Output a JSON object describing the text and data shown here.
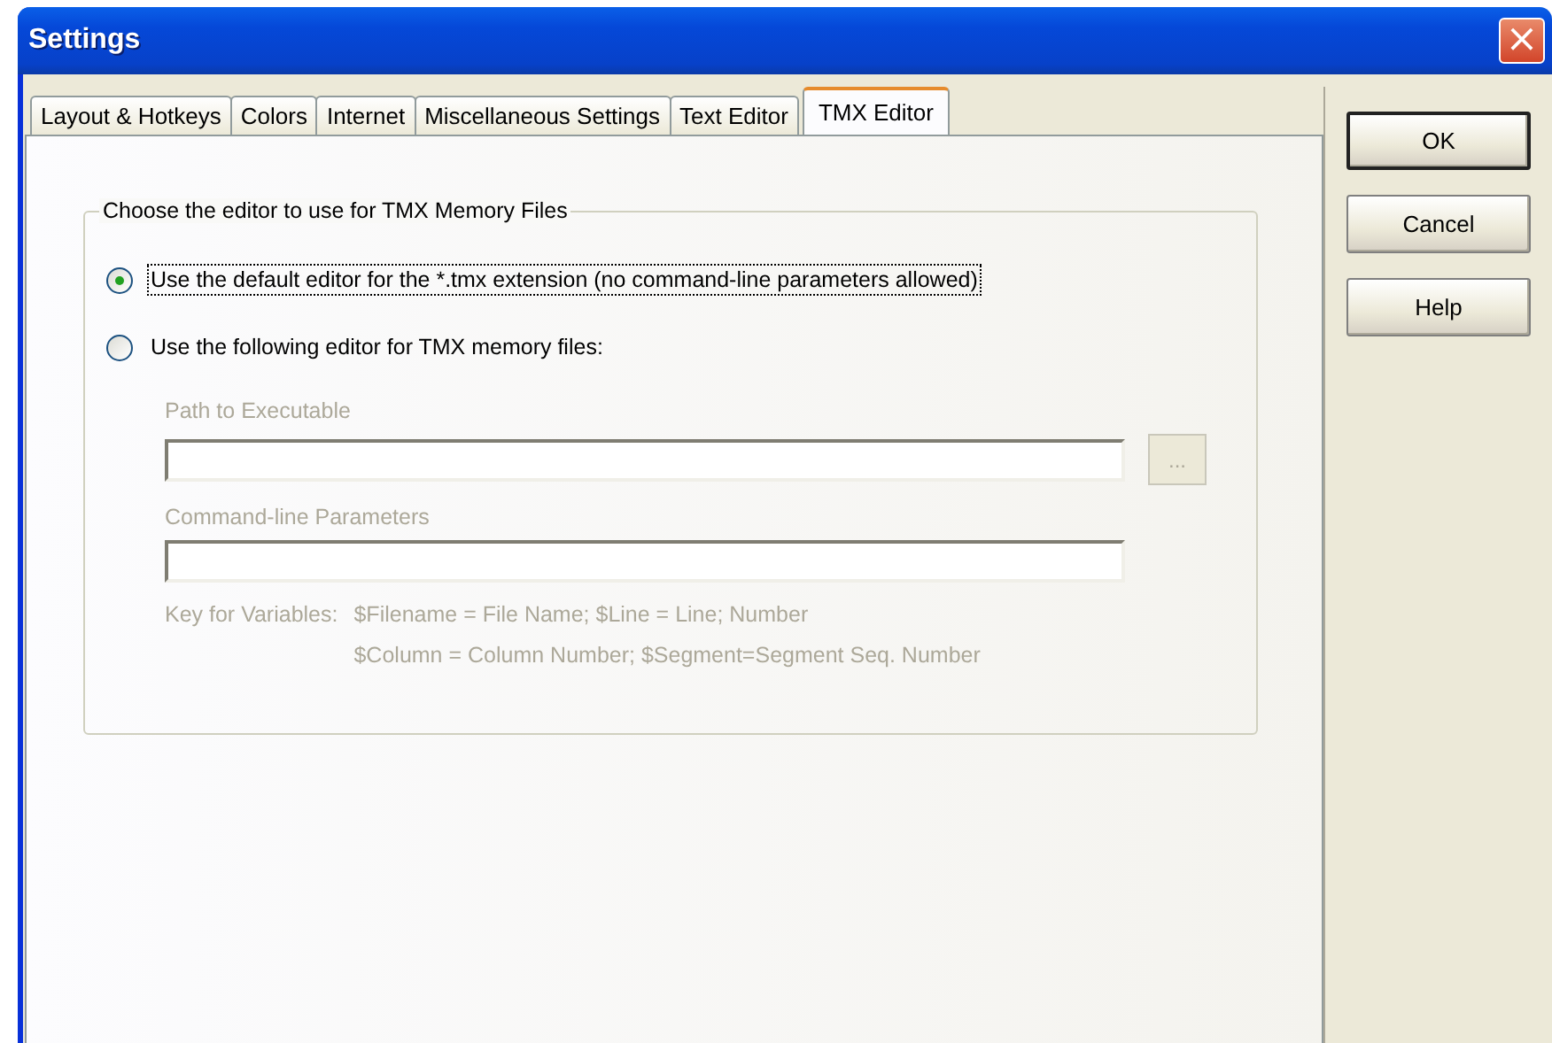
{
  "window": {
    "title": "Settings",
    "close_label": "×"
  },
  "tabs": [
    {
      "label": "Layout & Hotkeys",
      "selected": false
    },
    {
      "label": "Colors",
      "selected": false
    },
    {
      "label": "Internet",
      "selected": false
    },
    {
      "label": "Miscellaneous Settings",
      "selected": false
    },
    {
      "label": "Text Editor",
      "selected": false
    },
    {
      "label": "TMX Editor",
      "selected": true
    }
  ],
  "group": {
    "title": "Choose the editor to use for TMX Memory Files",
    "options": [
      {
        "label": "Use the default editor for the *.tmx extension (no command-line parameters allowed)",
        "selected": true,
        "focused": true
      },
      {
        "label": "Use the following editor for TMX memory files:",
        "selected": false,
        "focused": false
      }
    ],
    "path_label": "Path to Executable",
    "path_disabled": true,
    "browse_label": "...",
    "params_label": "Command-line Parameters",
    "params_disabled": true,
    "key_label": "Key for Variables:",
    "key_lines": [
      "$Filename = File Name; $Line = Line; Number",
      "$Column = Column Number; $Segment=Segment Seq. Number"
    ]
  },
  "buttons": [
    {
      "label": "OK",
      "default": true
    },
    {
      "label": "Cancel",
      "default": false
    },
    {
      "label": "Help",
      "default": false
    }
  ]
}
